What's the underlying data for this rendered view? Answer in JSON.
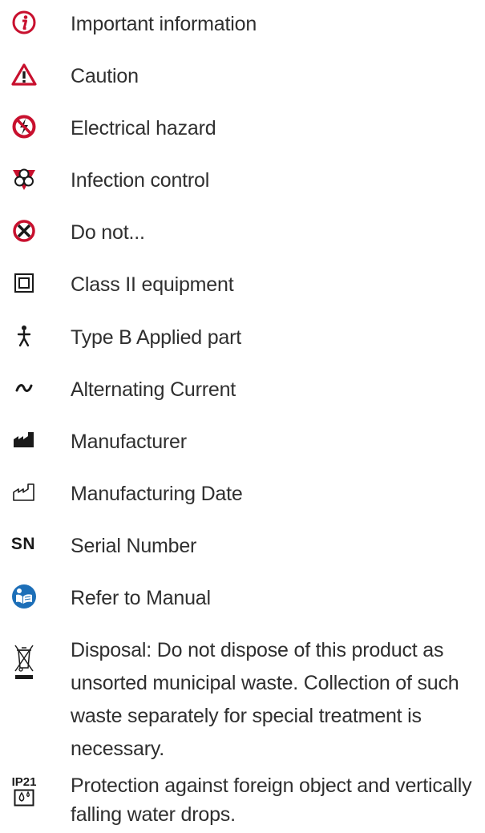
{
  "symbols": [
    {
      "icon": "important-information-icon",
      "label": "Important information"
    },
    {
      "icon": "caution-icon",
      "label": "Caution"
    },
    {
      "icon": "electrical-hazard-icon",
      "label": "Electrical hazard"
    },
    {
      "icon": "biohazard-icon",
      "label": "Infection control"
    },
    {
      "icon": "prohibition-icon",
      "label": "Do not..."
    },
    {
      "icon": "class-ii-equipment-icon",
      "label": "Class II equipment"
    },
    {
      "icon": "type-b-applied-part-icon",
      "label": "Type B Applied part"
    },
    {
      "icon": "alternating-current-icon",
      "label": "Alternating Current"
    },
    {
      "icon": "manufacturer-icon",
      "label": "Manufacturer"
    },
    {
      "icon": "manufacturing-date-icon",
      "label": "Manufacturing Date"
    },
    {
      "icon": "serial-number-icon",
      "icon_text": "SN",
      "label": "Serial Number"
    },
    {
      "icon": "refer-to-manual-icon",
      "label": "Refer to Manual"
    },
    {
      "icon": "weee-disposal-icon",
      "label": "Disposal: Do not dispose of this product as unsorted municipal waste. Collection of such waste separately for special treatment is necessary."
    },
    {
      "icon": "ip21-protection-icon",
      "icon_text": "IP21",
      "label": "Protection against foreign object and vertically falling water drops."
    }
  ],
  "colors": {
    "red": "#c8102e",
    "blue": "#1d6fb8",
    "text": "#2f2f2f"
  }
}
